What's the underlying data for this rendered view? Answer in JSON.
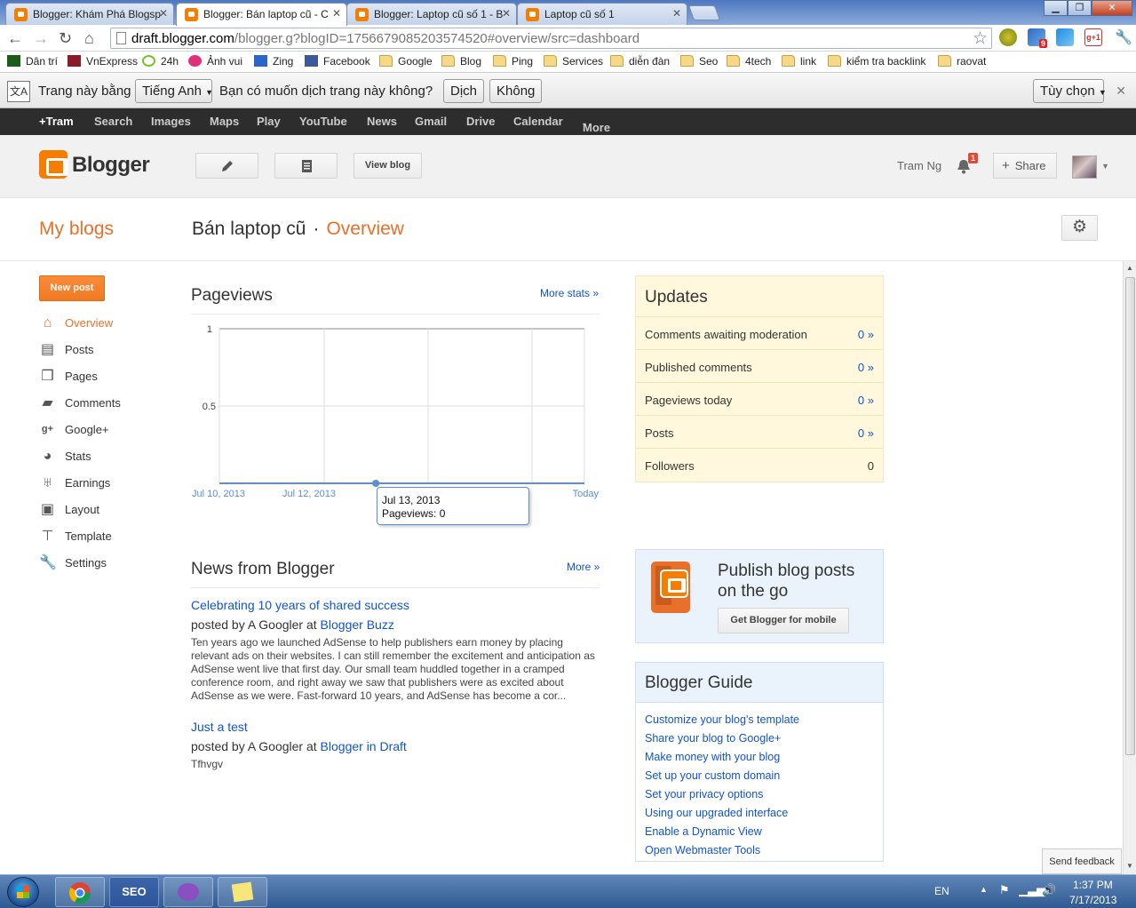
{
  "browser": {
    "tabs": [
      {
        "title": "Blogger: Khám Phá Blogsp"
      },
      {
        "title": "Blogger: Bán laptop cũ - C"
      },
      {
        "title": "Blogger: Laptop cũ số 1 - B"
      },
      {
        "title": "Laptop cũ số 1"
      }
    ],
    "url_host": "draft.blogger.com",
    "url_rest": "/blogger.g?blogID=1756679085203574520#overview/src=dashboard",
    "bookmarks": [
      "Dân trí",
      "VnExpress",
      "24h",
      "Ảnh vui",
      "Zing",
      "Facebook",
      "Google",
      "Blog",
      "Ping",
      "Services",
      "diễn đàn",
      "Seo",
      "4tech",
      "link",
      "kiểm tra backlink",
      "raovat"
    ],
    "translate": {
      "page_in": "Trang này bằng",
      "language": "Tiếng Anh",
      "question": "Bạn có muốn dịch trang này không?",
      "translate_btn": "Dịch",
      "no_btn": "Không",
      "options_btn": "Tùy chọn"
    },
    "ext_badges": {
      "ext1": "9",
      "ext2": "g+1"
    }
  },
  "gbar": {
    "items": [
      "+Tram",
      "Search",
      "Images",
      "Maps",
      "Play",
      "YouTube",
      "News",
      "Gmail",
      "Drive",
      "Calendar",
      "More"
    ]
  },
  "header": {
    "logo": "Blogger",
    "view_blog": "View blog",
    "user": "Tram Ng",
    "notifications": "1",
    "share": "Share"
  },
  "title": {
    "my_blogs": "My blogs",
    "blog_name": "Bán laptop cũ",
    "separator": "·",
    "page": "Overview"
  },
  "sidebar": {
    "new_post": "New post",
    "items": [
      {
        "label": "Overview",
        "icon": "home-icon"
      },
      {
        "label": "Posts",
        "icon": "posts-icon"
      },
      {
        "label": "Pages",
        "icon": "pages-icon"
      },
      {
        "label": "Comments",
        "icon": "comments-icon"
      },
      {
        "label": "Google+",
        "icon": "google-plus-icon"
      },
      {
        "label": "Stats",
        "icon": "stats-icon"
      },
      {
        "label": "Earnings",
        "icon": "trophy-icon"
      },
      {
        "label": "Layout",
        "icon": "layout-icon"
      },
      {
        "label": "Template",
        "icon": "template-icon"
      },
      {
        "label": "Settings",
        "icon": "wrench-icon"
      }
    ]
  },
  "pageviews": {
    "title": "Pageviews",
    "more": "More stats »",
    "tooltip_date": "Jul 13, 2013",
    "tooltip_value": "Pageviews: 0"
  },
  "chart_data": {
    "type": "line",
    "y_ticks": [
      "1",
      "0.5"
    ],
    "ylim": [
      0,
      1
    ],
    "x_labels": [
      "Jul 10, 2013",
      "Jul 12, 2013",
      "Today"
    ],
    "points": [
      0,
      0,
      0,
      0,
      0,
      0,
      0,
      0
    ],
    "highlight_index": 3,
    "line_color": "#5a8ed6"
  },
  "news": {
    "title": "News from Blogger",
    "more": "More »",
    "items": [
      {
        "title": "Celebrating 10 years of shared success",
        "posted_by": "posted by A Googler at",
        "source": "Blogger Buzz",
        "body": "Ten years ago we launched AdSense to help publishers earn money by placing relevant ads on their websites. I can still remember the excitement and anticipation as AdSense went live that first day. Our small team huddled together in a cramped conference room, and right away we saw that publishers were as excited about AdSense as we were. Fast-forward 10 years, and AdSense has become a cor..."
      },
      {
        "title": "Just a test",
        "posted_by": "posted by A Googler at",
        "source": "Blogger in Draft",
        "body": "Tfhvgv"
      }
    ]
  },
  "updates": {
    "title": "Updates",
    "rows": [
      {
        "label": "Comments awaiting moderation",
        "value": "0 »"
      },
      {
        "label": "Published comments",
        "value": "0 »"
      },
      {
        "label": "Pageviews today",
        "value": "0 »"
      },
      {
        "label": "Posts",
        "value": "0 »"
      },
      {
        "label": "Followers",
        "value": "0"
      }
    ]
  },
  "promo": {
    "text": "Publish blog posts on the go",
    "button": "Get Blogger for mobile"
  },
  "guide": {
    "title": "Blogger Guide",
    "links": [
      "Customize your blog's template",
      "Share your blog to Google+",
      "Make money with your blog",
      "Set up your custom domain",
      "Set your privacy options",
      "Using our upgraded interface",
      "Enable a Dynamic View",
      "Open Webmaster Tools"
    ]
  },
  "feedback": "Send feedback",
  "taskbar": {
    "lang": "EN",
    "time": "1:37 PM",
    "date": "7/17/2013",
    "app_seo": "SEO"
  }
}
